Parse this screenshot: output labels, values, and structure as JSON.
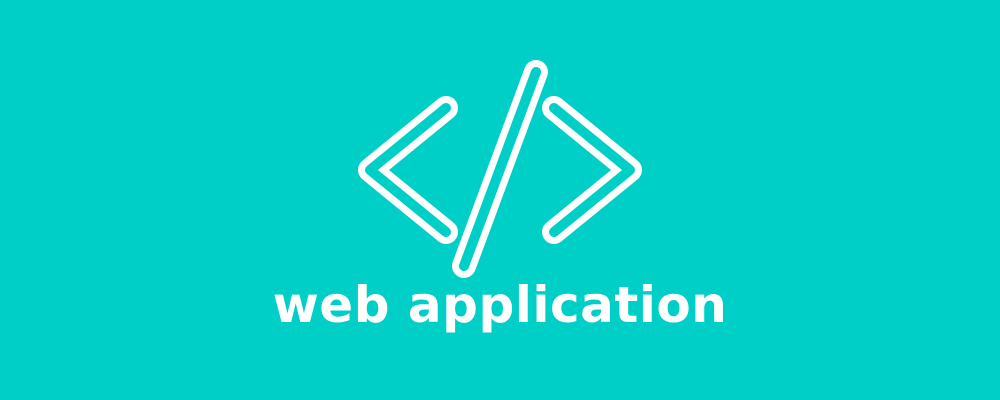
{
  "banner": {
    "title": "web application",
    "icon": "code-brackets-icon",
    "background_color": "#00CFC8",
    "foreground_color": "#FFFFFF"
  }
}
